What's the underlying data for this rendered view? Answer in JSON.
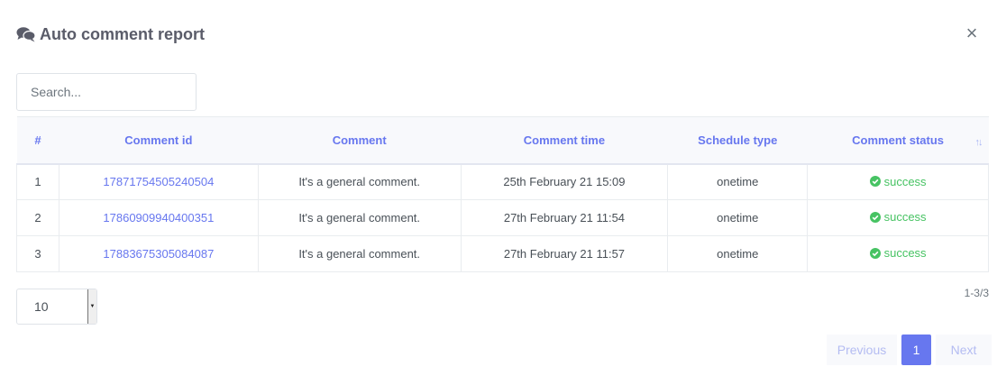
{
  "header": {
    "title": "Auto comment report",
    "icon": "comments-icon"
  },
  "close": {
    "label": "×"
  },
  "search": {
    "placeholder": "Search..."
  },
  "table": {
    "columns": [
      "#",
      "Comment id",
      "Comment",
      "Comment time",
      "Schedule type",
      "Comment status"
    ],
    "rows": [
      {
        "num": "1",
        "id": "17871754505240504",
        "comment": "It's a general comment.",
        "time": "25th February 21 15:09",
        "schedule": "onetime",
        "status": "success"
      },
      {
        "num": "2",
        "id": "17860909940400351",
        "comment": "It's a general comment.",
        "time": "27th February 21 11:54",
        "schedule": "onetime",
        "status": "success"
      },
      {
        "num": "3",
        "id": "17883675305084087",
        "comment": "It's a general comment.",
        "time": "27th February 21 11:57",
        "schedule": "onetime",
        "status": "success"
      }
    ]
  },
  "pagesize": {
    "value": "10"
  },
  "range": {
    "text": "1-3/3"
  },
  "pager": {
    "previous": "Previous",
    "current": "1",
    "next": "Next"
  },
  "colors": {
    "accent": "#6777ef",
    "success": "#47c363"
  }
}
